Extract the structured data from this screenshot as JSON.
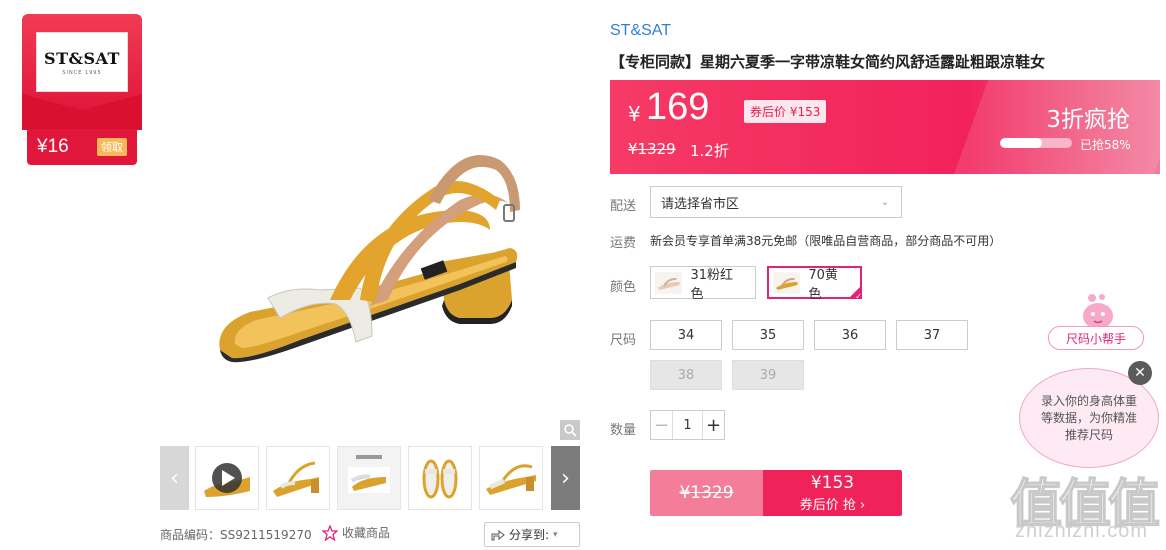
{
  "coupon": {
    "brand_logo": "ST&SAT",
    "brand_sub": "SINCE 1995",
    "amount": "¥16",
    "get_label": "领取"
  },
  "gallery": {
    "prev_label": "‹",
    "next_label": "›",
    "thumb_count": 5
  },
  "product": {
    "brand": "ST&SAT",
    "title": "【专柜同款】星期六夏季一字带凉鞋女简约风舒适露趾粗跟凉鞋女",
    "code_label": "商品编码：",
    "code": "SS9211519270",
    "favorite_label": "收藏商品",
    "share_label": "分享到:"
  },
  "price": {
    "currency": "¥",
    "value": "169",
    "after_coupon": "券后价 ¥153",
    "original": "¥1329",
    "discount": "1.2折",
    "promo_label": "3折疯抢",
    "sold_percent": 58,
    "sold_text": "已抢58%"
  },
  "delivery": {
    "label": "配送",
    "placeholder": "请选择省市区"
  },
  "shipping": {
    "label": "运费",
    "text": "新会员专享首单满38元免邮（限唯品自营商品，部分商品不可用）"
  },
  "colors": {
    "label": "颜色",
    "options": [
      {
        "name": "31粉红色",
        "selected": false
      },
      {
        "name": "70黄色",
        "selected": true
      }
    ]
  },
  "sizes": {
    "label": "尺码",
    "options": [
      {
        "value": "34",
        "available": true
      },
      {
        "value": "35",
        "available": true
      },
      {
        "value": "36",
        "available": true
      },
      {
        "value": "37",
        "available": true
      },
      {
        "value": "38",
        "available": false
      },
      {
        "value": "39",
        "available": false
      }
    ]
  },
  "quantity": {
    "label": "数量",
    "value": "1",
    "minus": "−",
    "plus": "+"
  },
  "buy": {
    "original": "¥1329",
    "price": "¥153",
    "action": "券后价 抢 ›"
  },
  "size_helper": {
    "pill_label": "尺码小帮手",
    "bubble_text": "录入你的身高体重等数据，为你精准推荐尺码",
    "close": "✕"
  },
  "watermark": {
    "glyphs": "值值值",
    "url": "zhizhizhi.com"
  },
  "colors_theme": {
    "accent": "#ef2259",
    "brand_blue": "#2f7fd8",
    "select_pink": "#e0247a"
  }
}
